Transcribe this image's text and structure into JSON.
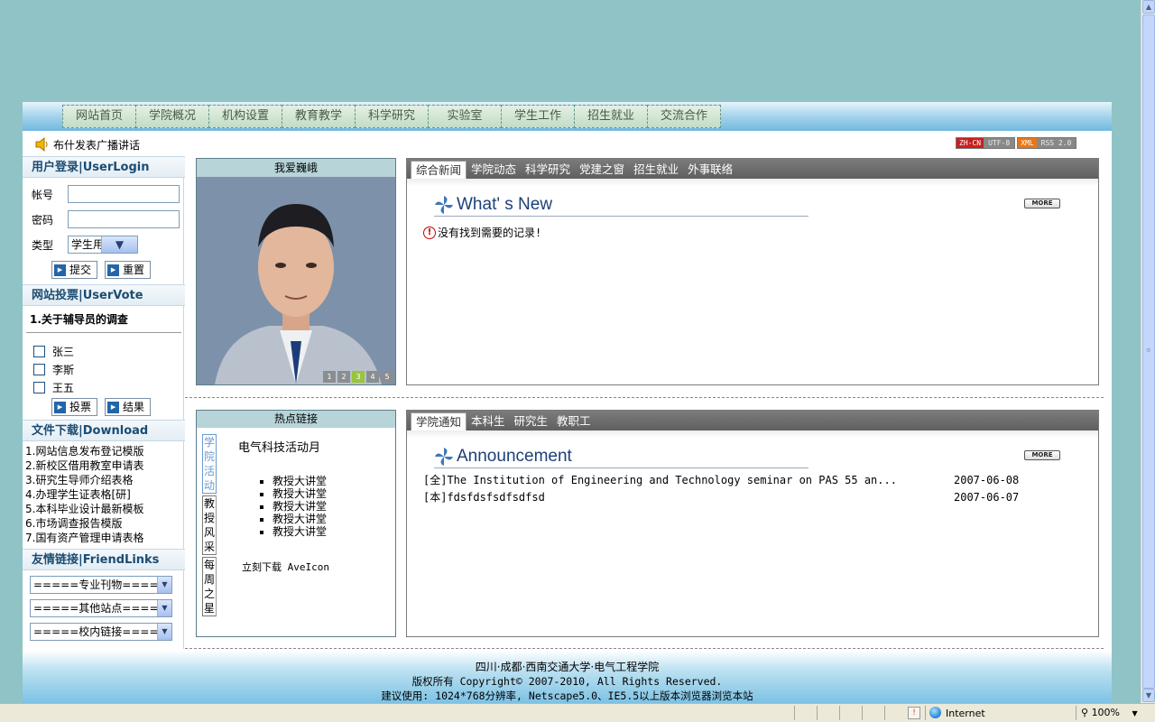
{
  "nav": {
    "items": [
      "网站首页",
      "学院概况",
      "机构设置",
      "教育教学",
      "科学研究",
      "实验室",
      "学生工作",
      "招生就业",
      "交流合作"
    ]
  },
  "top": {
    "announcement": "布什发表广播讲话",
    "badge1": {
      "a": "ZH-CN",
      "b": "UTF-8",
      "color": "#c8201e"
    },
    "badge2": {
      "a": "XML",
      "b": "RSS 2.0",
      "color": "#e8761a"
    }
  },
  "login": {
    "title": "用户登录|UserLogin",
    "account_label": "帐号",
    "password_label": "密码",
    "type_label": "类型",
    "type_value": "学生用户",
    "submit": "提交",
    "reset": "重置"
  },
  "vote": {
    "title": "网站投票|UserVote",
    "question": "1.关于辅导员的调查",
    "options": [
      "张三",
      "李斯",
      "王五"
    ],
    "vote_btn": "投票",
    "result_btn": "结果"
  },
  "download": {
    "title": "文件下载|Download",
    "items": [
      "1.网站信息发布登记模版",
      "2.新校区借用教室申请表",
      "3.研究生导师介绍表格",
      "4.办理学生证表格[研]",
      "5.本科毕业设计最新模板",
      "6.市场调查报告模版",
      "7.国有资产管理申请表格"
    ]
  },
  "friendlinks": {
    "title": "友情链接|FriendLinks",
    "selects": [
      "=====专业刊物=====",
      "=====其他站点=====",
      "=====校内链接====="
    ]
  },
  "photo": {
    "header": "我爱巍峨",
    "pages": [
      "1",
      "2",
      "3",
      "4",
      "5"
    ],
    "active_page": 3
  },
  "news": {
    "tabs": [
      "综合新闻",
      "学院动态",
      "科学研究",
      "党建之窗",
      "招生就业",
      "外事联络"
    ],
    "heading": "What' s New",
    "more": "MORE",
    "empty": "没有找到需要的记录!"
  },
  "hot": {
    "header": "热点链接",
    "vtabs": [
      "学院活动",
      "教授风采",
      "每周之星"
    ],
    "title": "电气科技活动月",
    "list": [
      "教授大讲堂",
      "教授大讲堂",
      "教授大讲堂",
      "教授大讲堂",
      "教授大讲堂"
    ],
    "download": "立刻下载 AveIcon"
  },
  "notice": {
    "tabs": [
      "学院通知",
      "本科生",
      "研究生",
      "教职工"
    ],
    "heading": "Announcement",
    "more": "MORE",
    "rows": [
      {
        "title": "[全]The Institution of Engineering and Technology seminar on PAS 55 an...",
        "date": "2007-06-08"
      },
      {
        "title": "[本]fdsfdsfsdfsdfsd",
        "date": "2007-06-07"
      }
    ]
  },
  "footer": {
    "line1": "四川·成都·西南交通大学·电气工程学院",
    "line2": "版权所有 Copyright© 2007-2010, All Rights Reserved.",
    "line3": "建议使用: 1024*768分辨率, Netscape5.0、IE5.5以上版本浏览器浏览本站"
  },
  "status": {
    "zone": "Internet",
    "zoom": "100%"
  }
}
